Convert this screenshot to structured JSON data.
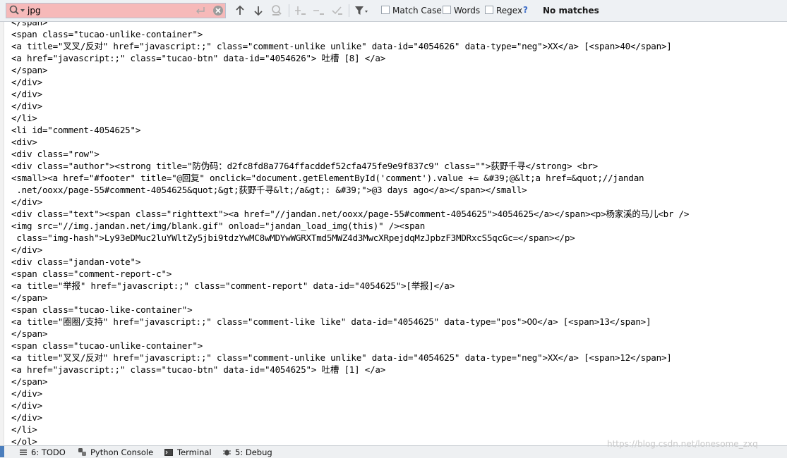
{
  "search": {
    "query": "jpg",
    "match_case_label": "Match Case",
    "words_label": "Words",
    "regex_label": "Regex",
    "help_label": "?",
    "status": "No matches",
    "icons": [
      "search-dropdown-icon",
      "newline-icon",
      "clear-icon",
      "arrow-up-icon",
      "arrow-down-icon",
      "find-all-icon",
      "add-selection-icon",
      "remove-selection-icon",
      "select-all-icon",
      "filter-icon"
    ],
    "colors": {
      "no_match_bg": "#f6b9b9"
    }
  },
  "editor": {
    "lines": [
      "</span>",
      "<span class=\"tucao-unlike-container\">",
      "<a title=\"叉叉/反对\" href=\"javascript:;\" class=\"comment-unlike unlike\" data-id=\"4054626\" data-type=\"neg\">XX</a> [<span>40</span>]",
      "<a href=\"javascript:;\" class=\"tucao-btn\" data-id=\"4054626\"> 吐槽 [8] </a>",
      "</span>",
      "</div>",
      "</div>",
      "</div>",
      "</li>",
      "<li id=\"comment-4054625\">",
      "<div>",
      "<div class=\"row\">",
      "<div class=\"author\"><strong title=\"防伪码：d2fc8fd8a7764ffacddef52cfa475fe9e9f837c9\" class=\"\">荻野千寻</strong> <br>",
      "<small><a href=\"#footer\" title=\"@回复\" onclick=\"document.getElementById('comment').value += &#39;@&lt;a href=&quot;//jandan",
      " .net/ooxx/page-55#comment-4054625&quot;&gt;荻野千寻&lt;/a&gt;: &#39;\">@3 days ago</a></span></small>",
      "</div>",
      "<div class=\"text\"><span class=\"righttext\"><a href=\"//jandan.net/ooxx/page-55#comment-4054625\">4054625</a></span><p>杨家溪的马儿<br />",
      "<img src=\"//img.jandan.net/img/blank.gif\" onload=\"jandan_load_img(this)\" /><span",
      " class=\"img-hash\">Ly93eDMuc2luYWltZy5jbi9tdzYwMC8wMDYwWGRXTmd5MWZ4d3MwcXRpejdqMzJpbzF3MDRxcS5qcGc=</span></p>",
      "</div>",
      "<div class=\"jandan-vote\">",
      "<span class=\"comment-report-c\">",
      "<a title=\"举报\" href=\"javascript:;\" class=\"comment-report\" data-id=\"4054625\">[举报]</a>",
      "</span>",
      "<span class=\"tucao-like-container\">",
      "<a title=\"圈圈/支持\" href=\"javascript:;\" class=\"comment-like like\" data-id=\"4054625\" data-type=\"pos\">OO</a> [<span>13</span>]",
      "</span>",
      "<span class=\"tucao-unlike-container\">",
      "<a title=\"叉叉/反对\" href=\"javascript:;\" class=\"comment-unlike unlike\" data-id=\"4054625\" data-type=\"neg\">XX</a> [<span>12</span>]",
      "<a href=\"javascript:;\" class=\"tucao-btn\" data-id=\"4054625\"> 吐槽 [1] </a>",
      "</span>",
      "</div>",
      "</div>",
      "</div>",
      "</li>",
      "</ol>"
    ]
  },
  "bottom_bar": {
    "todo": "6: TODO",
    "python_console": "Python Console",
    "terminal": "Terminal",
    "debug": "5: Debug",
    "watermark": "https://blog.csdn.net/lonesome_zxq"
  }
}
